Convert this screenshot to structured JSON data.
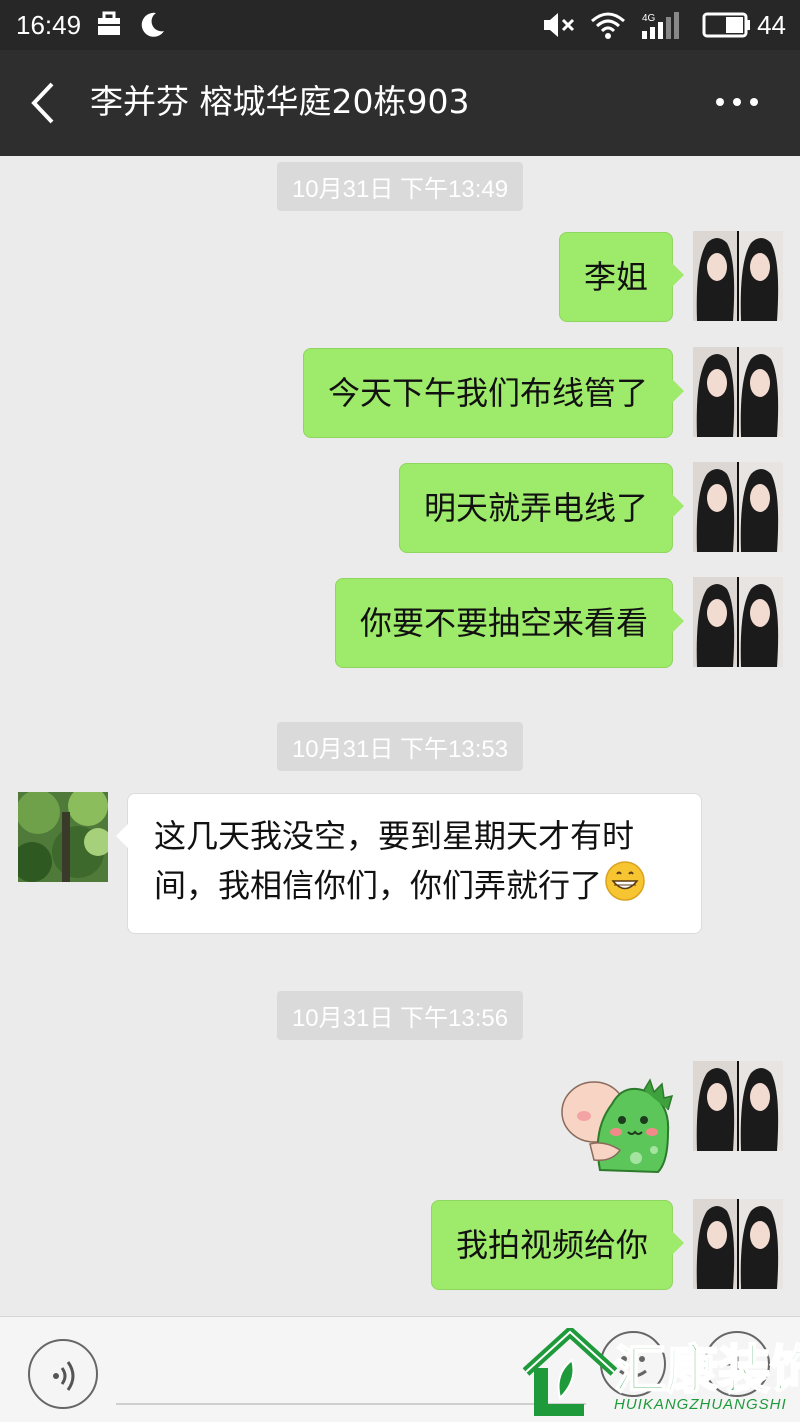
{
  "status_bar": {
    "time": "16:49",
    "battery": "44",
    "network": "4G",
    "icons": [
      "briefcase-icon",
      "moon-icon",
      "mute-icon",
      "wifi-icon",
      "signal-icon",
      "battery-icon"
    ]
  },
  "header": {
    "title": "李并芬 榕城华庭20栋903",
    "back_icon": "chevron-left-icon",
    "more_icon": "more-dots-icon"
  },
  "messages": [
    {
      "type": "timestamp",
      "text": "10月31日 下午13:49"
    },
    {
      "type": "text",
      "direction": "out",
      "text": "李姐"
    },
    {
      "type": "text",
      "direction": "out",
      "text": "今天下午我们布线管了"
    },
    {
      "type": "text",
      "direction": "out",
      "text": "明天就弄电线了"
    },
    {
      "type": "text",
      "direction": "out",
      "text": "你要不要抽空来看看"
    },
    {
      "type": "timestamp",
      "text": "10月31日 下午13:53"
    },
    {
      "type": "text",
      "direction": "in",
      "line1": "这几天我没空，要到星期天才有时",
      "line2": "间，我相信你们，你们弄就行了",
      "emoji": "grin-emoji"
    },
    {
      "type": "timestamp",
      "text": "10月31日 下午13:56"
    },
    {
      "type": "sticker",
      "direction": "out",
      "sticker": "green-dinosaur-hug-sticker"
    },
    {
      "type": "text",
      "direction": "out",
      "text": "我拍视频给你"
    }
  ],
  "input_bar": {
    "voice_icon": "voice-icon",
    "emoji_icon": "emoji-icon",
    "plus_icon": "plus-icon"
  },
  "watermark": {
    "text": "汇康装饰",
    "subtext": "HUIKANGZHUANGSHI"
  },
  "colors": {
    "outgoing_bubble": "#9eea6a",
    "incoming_bubble": "#ffffff",
    "background": "#ebebeb",
    "header": "#2e2e2e",
    "watermark": "#1f9a3a"
  }
}
